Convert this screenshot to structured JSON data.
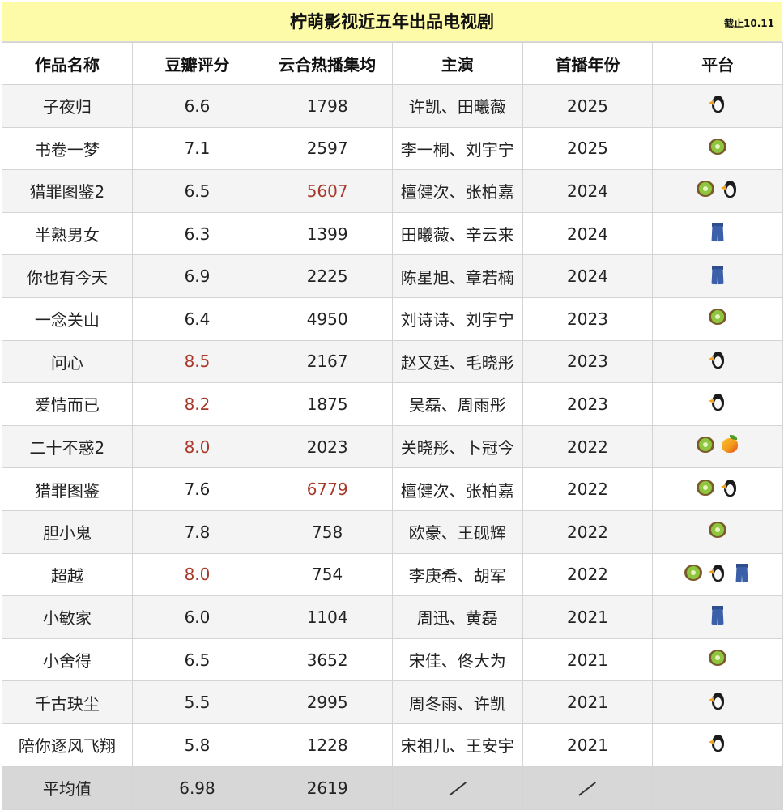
{
  "title": "柠萌影视近五年出品电视剧",
  "cutoff_note": "截止10.11",
  "headers": [
    "作品名称",
    "豆瓣评分",
    "云合热播集均",
    "主演",
    "首播年份",
    "平台"
  ],
  "rows": [
    {
      "name": "子夜归",
      "score": "6.6",
      "views": "1798",
      "cast": "许凯、田曦薇",
      "year": "2025",
      "platforms": [
        "penguin"
      ]
    },
    {
      "name": "书卷一梦",
      "score": "7.1",
      "views": "2597",
      "cast": "李一桐、刘宇宁",
      "year": "2025",
      "platforms": [
        "kiwi"
      ]
    },
    {
      "name": "猎罪图鉴2",
      "score": "6.5",
      "views": "5607",
      "cast": "檀健次、张柏嘉",
      "year": "2024",
      "platforms": [
        "kiwi",
        "penguin"
      ]
    },
    {
      "name": "半熟男女",
      "score": "6.3",
      "views": "1399",
      "cast": "田曦薇、辛云来",
      "year": "2024",
      "platforms": [
        "jeans"
      ]
    },
    {
      "name": "你也有今天",
      "score": "6.9",
      "views": "2225",
      "cast": "陈星旭、章若楠",
      "year": "2024",
      "platforms": [
        "jeans"
      ]
    },
    {
      "name": "一念关山",
      "score": "6.4",
      "views": "4950",
      "cast": "刘诗诗、刘宇宁",
      "year": "2023",
      "platforms": [
        "kiwi"
      ]
    },
    {
      "name": "问心",
      "score": "8.5",
      "views": "2167",
      "cast": "赵又廷、毛晓彤",
      "year": "2023",
      "platforms": [
        "penguin"
      ]
    },
    {
      "name": "爱情而已",
      "score": "8.2",
      "views": "1875",
      "cast": "吴磊、周雨彤",
      "year": "2023",
      "platforms": [
        "penguin"
      ]
    },
    {
      "name": "二十不惑2",
      "score": "8.0",
      "views": "2023",
      "cast": "关晓彤、卜冠今",
      "year": "2022",
      "platforms": [
        "kiwi",
        "mango"
      ]
    },
    {
      "name": "猎罪图鉴",
      "score": "7.6",
      "views": "6779",
      "cast": "檀健次、张柏嘉",
      "year": "2022",
      "platforms": [
        "kiwi",
        "penguin"
      ]
    },
    {
      "name": "胆小鬼",
      "score": "7.8",
      "views": "758",
      "cast": "欧豪、王砚辉",
      "year": "2022",
      "platforms": [
        "kiwi"
      ]
    },
    {
      "name": "超越",
      "score": "8.0",
      "views": "754",
      "cast": "李庚希、胡军",
      "year": "2022",
      "platforms": [
        "kiwi",
        "penguin",
        "jeans"
      ]
    },
    {
      "name": "小敏家",
      "score": "6.0",
      "views": "1104",
      "cast": "周迅、黄磊",
      "year": "2021",
      "platforms": [
        "jeans"
      ]
    },
    {
      "name": "小舍得",
      "score": "6.5",
      "views": "3652",
      "cast": "宋佳、佟大为",
      "year": "2021",
      "platforms": [
        "kiwi"
      ]
    },
    {
      "name": "千古玦尘",
      "score": "5.5",
      "views": "2995",
      "cast": "周冬雨、许凯",
      "year": "2021",
      "platforms": [
        "penguin"
      ]
    },
    {
      "name": "陪你逐风飞翔",
      "score": "5.8",
      "views": "1228",
      "cast": "宋祖儿、王安宇",
      "year": "2021",
      "platforms": [
        "penguin"
      ]
    }
  ],
  "average": {
    "label": "平均值",
    "score": "6.98",
    "views": "2619"
  },
  "highlight_scores": [
    "8.5",
    "8.2",
    "8.0"
  ],
  "highlight_views": [
    "5607",
    "6779"
  ],
  "colors": {
    "title_bg": "#fdfba8",
    "highlight": "#a8392b",
    "avg_bg": "#d7d7d7"
  }
}
